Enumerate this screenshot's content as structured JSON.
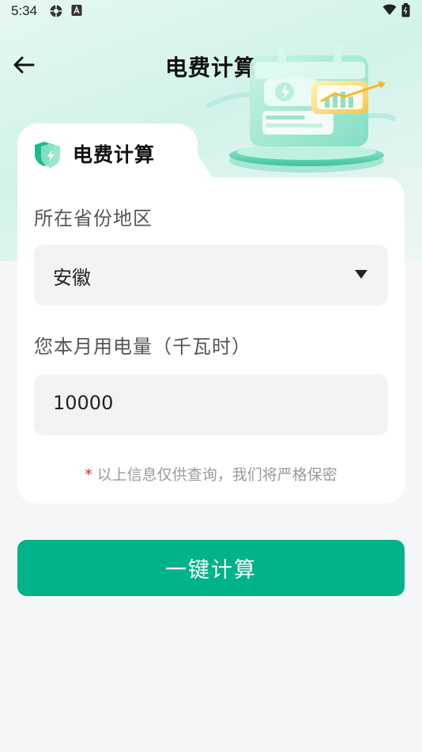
{
  "status_bar": {
    "time": "5:34"
  },
  "nav": {
    "title": "电费计算"
  },
  "card": {
    "title": "电费计算",
    "province_label": "所在省份地区",
    "province_value": "安徽",
    "usage_label": "您本月用电量（千瓦时）",
    "usage_value": "10000",
    "notice_star": "*",
    "notice_text": "以上信息仅供查询，我们将严格保密"
  },
  "actions": {
    "calculate_label": "一键计算"
  },
  "colors": {
    "accent": "#00b388",
    "required_star": "#e02020"
  }
}
